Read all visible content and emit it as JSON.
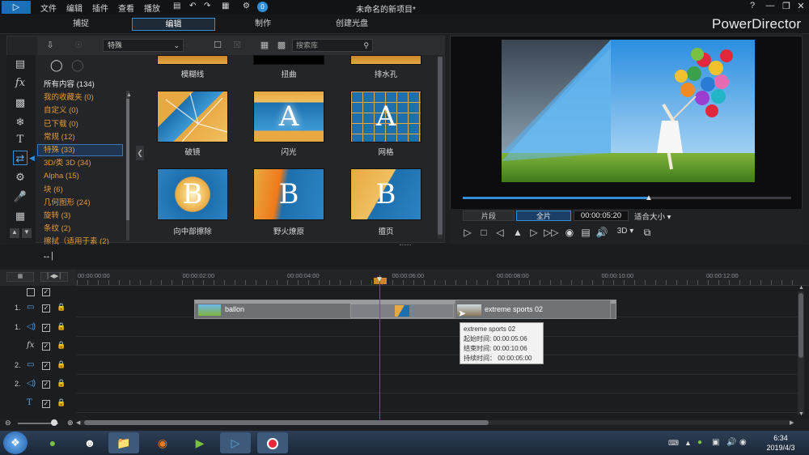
{
  "menu": [
    "文件",
    "编辑",
    "插件",
    "查看",
    "播放"
  ],
  "title": "未命名的新项目*",
  "window_controls": [
    "?",
    "—",
    "❐",
    "✕"
  ],
  "tabs": [
    "捕捉",
    "编辑",
    "制作",
    "创建光盘"
  ],
  "brand": "PowerDirector",
  "library": {
    "dropdown": "特殊",
    "search_placeholder": "搜索库",
    "categories": [
      {
        "label": "所有内容 (134)",
        "white": true
      },
      {
        "label": "我的收藏夹 (0)"
      },
      {
        "label": "自定义 (0)"
      },
      {
        "label": "已下载 (0)"
      },
      {
        "label": "常规 (12)"
      },
      {
        "label": "特殊 (33)"
      },
      {
        "label": "3D/类 3D (34)"
      },
      {
        "label": "Alpha (15)"
      },
      {
        "label": "块 (6)"
      },
      {
        "label": "几何图形 (24)"
      },
      {
        "label": "旋转 (3)"
      },
      {
        "label": "条纹 (2)"
      },
      {
        "label": "擦拭（适用于素 (2)"
      }
    ],
    "top_labels": [
      "模糊线",
      "扭曲",
      "排水孔"
    ],
    "items": [
      {
        "label": "破镜",
        "letter": ""
      },
      {
        "label": "闪光",
        "letter": "A"
      },
      {
        "label": "网格",
        "letter": "A"
      },
      {
        "label": "向中部擦除",
        "letter": "B"
      },
      {
        "label": "野火燎原",
        "letter": "B"
      },
      {
        "label": "擅页",
        "letter": "B"
      }
    ]
  },
  "preview": {
    "clip_button": "片段",
    "full_button": "全片",
    "timecode": "00:00:05:20",
    "fit": "适合大小",
    "threed": "3D",
    "progress": 0.56
  },
  "ruler": [
    "00:00:00:00",
    "00:00:02:00",
    "00:00:04:00",
    "00:00:06:00",
    "00:00:08:00",
    "00:00:10:00",
    "00:00:12:00"
  ],
  "tracks": [
    {
      "num": "1.",
      "icon": "video"
    },
    {
      "num": "1.",
      "icon": "audio"
    },
    {
      "num": "",
      "icon": "fx"
    },
    {
      "num": "2.",
      "icon": "video"
    },
    {
      "num": "2.",
      "icon": "audio"
    },
    {
      "num": "",
      "icon": "title"
    }
  ],
  "clips": {
    "clip1": "ballon",
    "clip2": "extreme sports 02"
  },
  "tooltip": {
    "name": "extreme sports 02",
    "start": "起始时间: 00:00:05:06",
    "end": "结束时间: 00:00:10:06",
    "duration": "持续时间： 00:00:05:00"
  },
  "clock": {
    "time": "6:34",
    "date": "2019/4/3"
  },
  "colors": {
    "accent": "#2f8fd8",
    "orange": "#e39a3c",
    "playhead": "#c0392b"
  }
}
